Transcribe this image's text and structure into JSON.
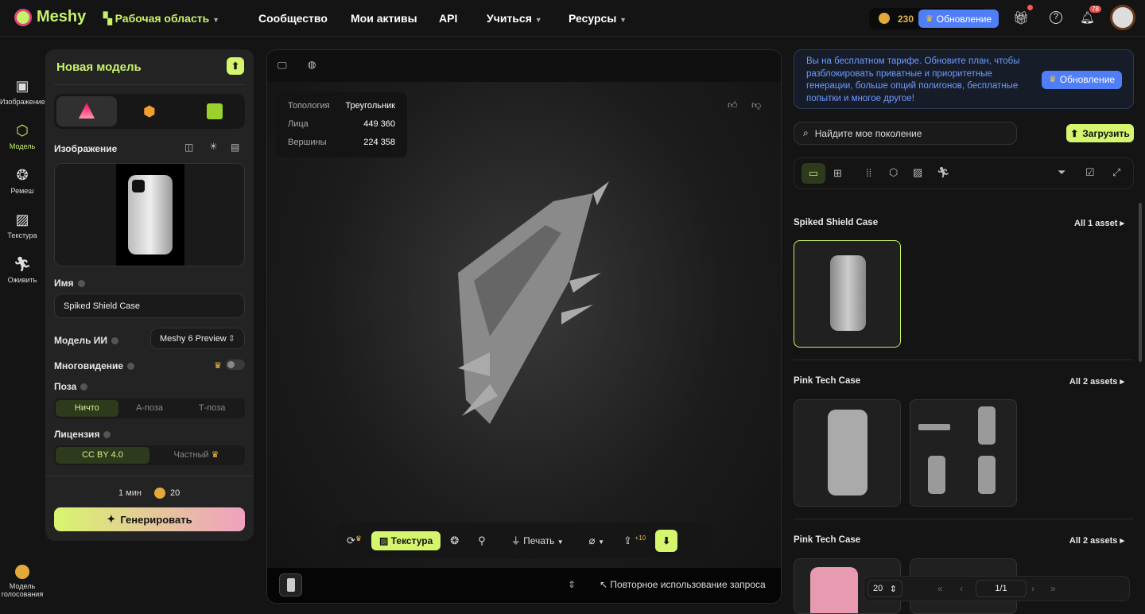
{
  "header": {
    "logo": "Meshy",
    "workspace": "Рабочая область",
    "nav": [
      "Сообщество",
      "Мои активы",
      "API",
      "Учиться",
      "Ресурсы"
    ],
    "credits": "230",
    "upgrade": "Обновление",
    "notifications": "78"
  },
  "rail": [
    {
      "label": "Изображение",
      "icon": "image-ai-icon"
    },
    {
      "label": "Модель",
      "icon": "cube-icon"
    },
    {
      "label": "Ремеш",
      "icon": "mesh-icon"
    },
    {
      "label": "Текстура",
      "icon": "texture-icon"
    },
    {
      "label": "Оживить",
      "icon": "run-icon"
    }
  ],
  "rail_bottom": "Модель голосования",
  "left": {
    "title": "Новая модель",
    "image_label": "Изображение",
    "name_label": "Имя",
    "name_value": "Spiked Shield Case",
    "ai_label": "Модель ИИ",
    "ai_value": "Meshy 6 Preview",
    "multiview_label": "Многовидение",
    "pose_label": "Поза",
    "pose_options": [
      "Ничто",
      "А-поза",
      "Т-поза"
    ],
    "license_label": "Лицензия",
    "license_options": [
      "CC BY 4.0",
      "Частный"
    ],
    "time": "1 мин",
    "cost": "20",
    "generate": "Генерировать"
  },
  "viewer": {
    "stats": [
      {
        "k": "Топология",
        "v": "Треугольник"
      },
      {
        "k": "Лица",
        "v": "449 360"
      },
      {
        "k": "Вершины",
        "v": "224 358"
      }
    ],
    "texture": "Текстура",
    "print": "Печать",
    "plus": "+10",
    "reuse": "Повторное использование запроса"
  },
  "right": {
    "banner": "Вы на бесплатном тарифе. Обновите план, чтобы разблокировать приватные и приоритетные генерации, больше опций полигонов, бесплатные попытки и многое другое!",
    "upgrade": "Обновление",
    "search_placeholder": "Найдите мое поколение",
    "upload": "Загрузить",
    "groups": [
      {
        "title": "Spiked Shield Case",
        "all": "All 1 asset"
      },
      {
        "title": "Pink Tech Case",
        "all": "All 2 assets"
      },
      {
        "title": "Pink Tech Case",
        "all": "All 2 assets"
      }
    ],
    "page_size": "20",
    "page": "1/1"
  }
}
